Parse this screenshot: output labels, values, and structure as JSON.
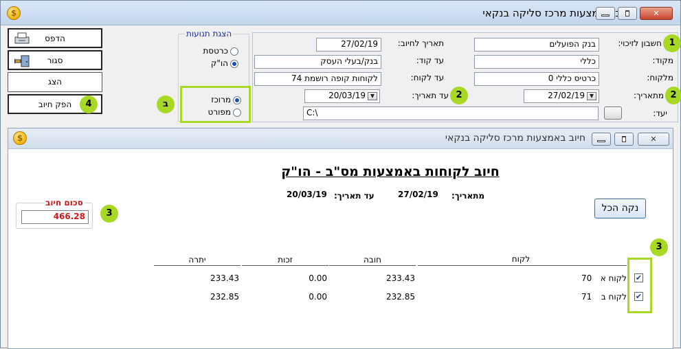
{
  "window": {
    "title": "חיוב באמצעות מרכז סליקה בנקאי",
    "app_icon": "$"
  },
  "fields": {
    "credit_account_label": "חשבון לזיכוי:",
    "credit_account_value": "בנק הפועלים",
    "from_code_label": "מקוד:",
    "from_code_value": "כללי",
    "from_customer_label": "מלקוח:",
    "from_customer_value": "כרטיס כללי 0",
    "from_date_label": "מתאריך:",
    "from_date_value": "27/02/19",
    "to_label": "יעד:",
    "charge_date_label": "תאריך לחיוב:",
    "charge_date_value": "27/02/19",
    "to_code_label": "עד קוד:",
    "to_code_value": "בנק/בעלי העסק",
    "to_customer_label": "עד לקוח:",
    "to_customer_value": "לקוחות קופה רושמת  74",
    "to_date_label": "עד תאריך:",
    "to_date_value": "20/03/19",
    "path_value": "C:\\"
  },
  "transactions_group": {
    "title": "הצגת תנועות",
    "options": [
      "כרטסת",
      "הו\"ק"
    ],
    "selected": "הו\"ק",
    "mode_options": [
      "מרוכז",
      "מפורט"
    ],
    "mode_selected": "מרוכז"
  },
  "actions": {
    "print": "הדפס",
    "close": "סגור",
    "show": "הצג",
    "issue_charge": "הפק חיוב"
  },
  "markers": {
    "m1": "1",
    "m2a": "2",
    "m2b": "2",
    "mb": "ב",
    "m3a": "3",
    "m3b": "3",
    "m4": "4"
  },
  "report": {
    "window_title": "חיוב באמצעות מרכז סליקה בנקאי",
    "title": "חיוב לקוחות באמצעות מס\"ב - הו\"ק",
    "from_date_label": "מתאריך:",
    "from_date_value": "27/02/19",
    "to_date_label": "עד תאריך:",
    "to_date_value": "20/03/19",
    "sum_label": "סכום חיוב",
    "sum_value": "466.28",
    "clear_all": "נקה הכל",
    "columns": {
      "customer": "לקוח",
      "debit": "חובה",
      "credit": "זכות",
      "balance": "יתרה"
    },
    "rows": [
      {
        "checked": true,
        "name": "לקוח א",
        "code": "70",
        "debit": "233.43",
        "credit": "0.00",
        "balance": "233.43"
      },
      {
        "checked": true,
        "name": "לקוח ב",
        "code": "71",
        "debit": "232.85",
        "credit": "0.00",
        "balance": "232.85"
      }
    ]
  },
  "colors": {
    "marker": "#a8d826",
    "sum_red": "#d01818",
    "group_title": "#1b2aa0"
  }
}
